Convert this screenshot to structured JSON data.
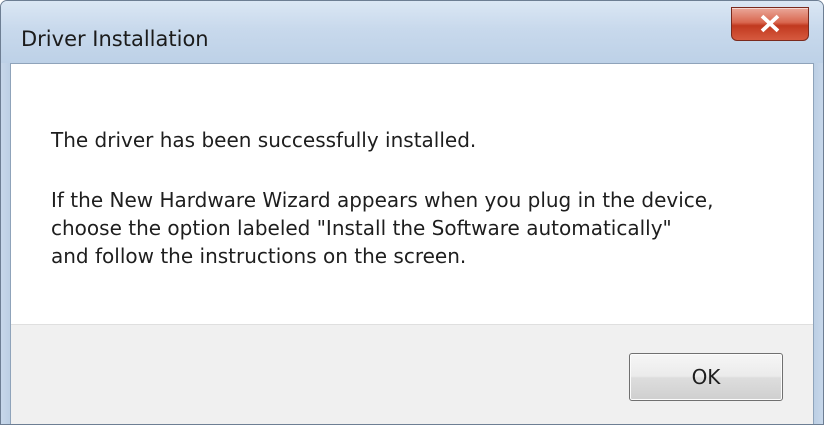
{
  "window": {
    "title": "Driver Installation"
  },
  "title_buttons": {
    "close_icon": "close-x-icon"
  },
  "message": {
    "line1": "The driver has been successfully installed.",
    "para_lines": [
      "If the New Hardware Wizard appears when you plug in the device,",
      "choose the option labeled \"Install the Software automatically\"",
      "and follow the instructions on the screen."
    ]
  },
  "buttons": {
    "ok_label": "OK"
  },
  "colors": {
    "close_button": "#c1391f",
    "frame": "#bccfe4",
    "footer": "#f0f0f0"
  }
}
